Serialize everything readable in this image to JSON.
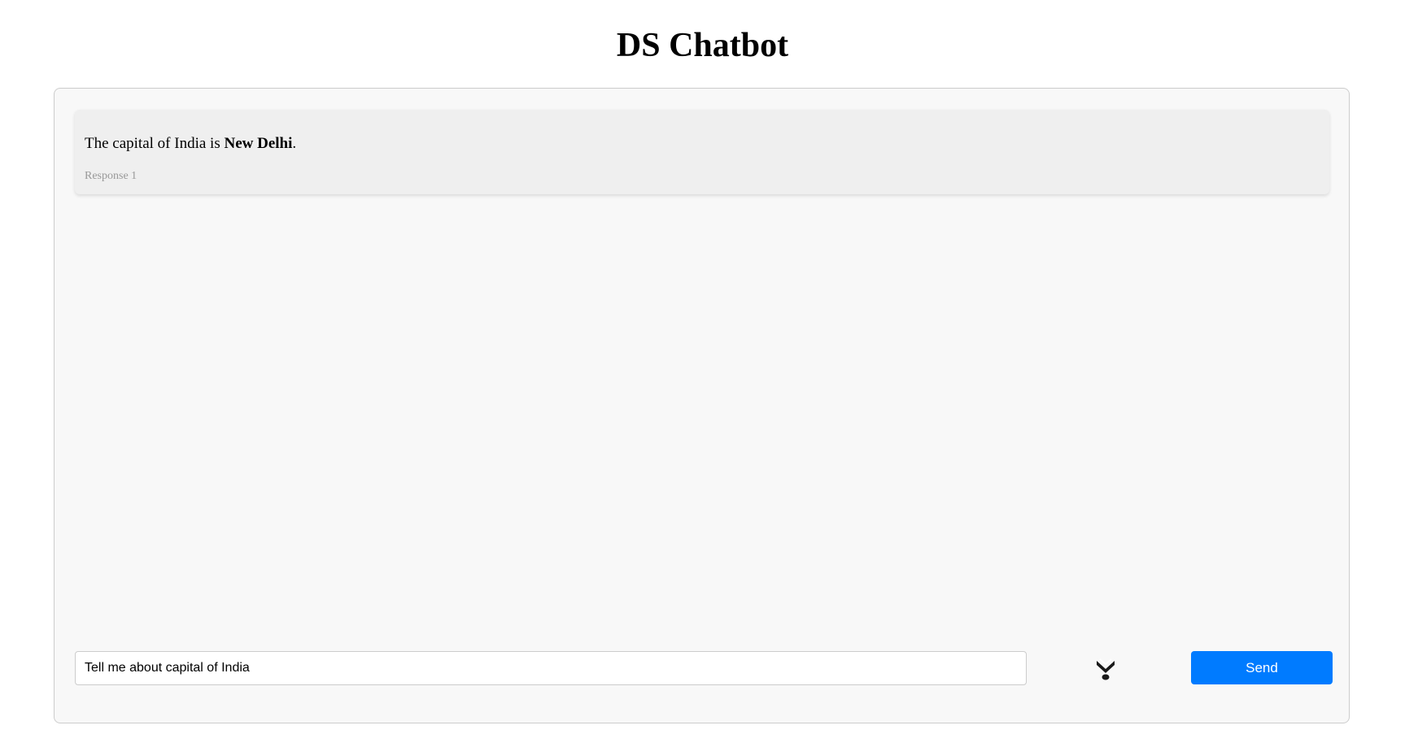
{
  "page": {
    "title": "DS Chatbot"
  },
  "chat": {
    "messages": [
      {
        "text_before": "The capital of India is ",
        "text_bold": "New Delhi",
        "text_after": ".",
        "meta": "Response 1"
      }
    ]
  },
  "composer": {
    "input_value": "Tell me about capital of India",
    "mic_icon": "microphone-icon",
    "send_label": "Send"
  },
  "colors": {
    "accent": "#007bff",
    "panel_background": "#f8f8f8",
    "message_background": "#efefef",
    "meta_text": "#999999"
  }
}
